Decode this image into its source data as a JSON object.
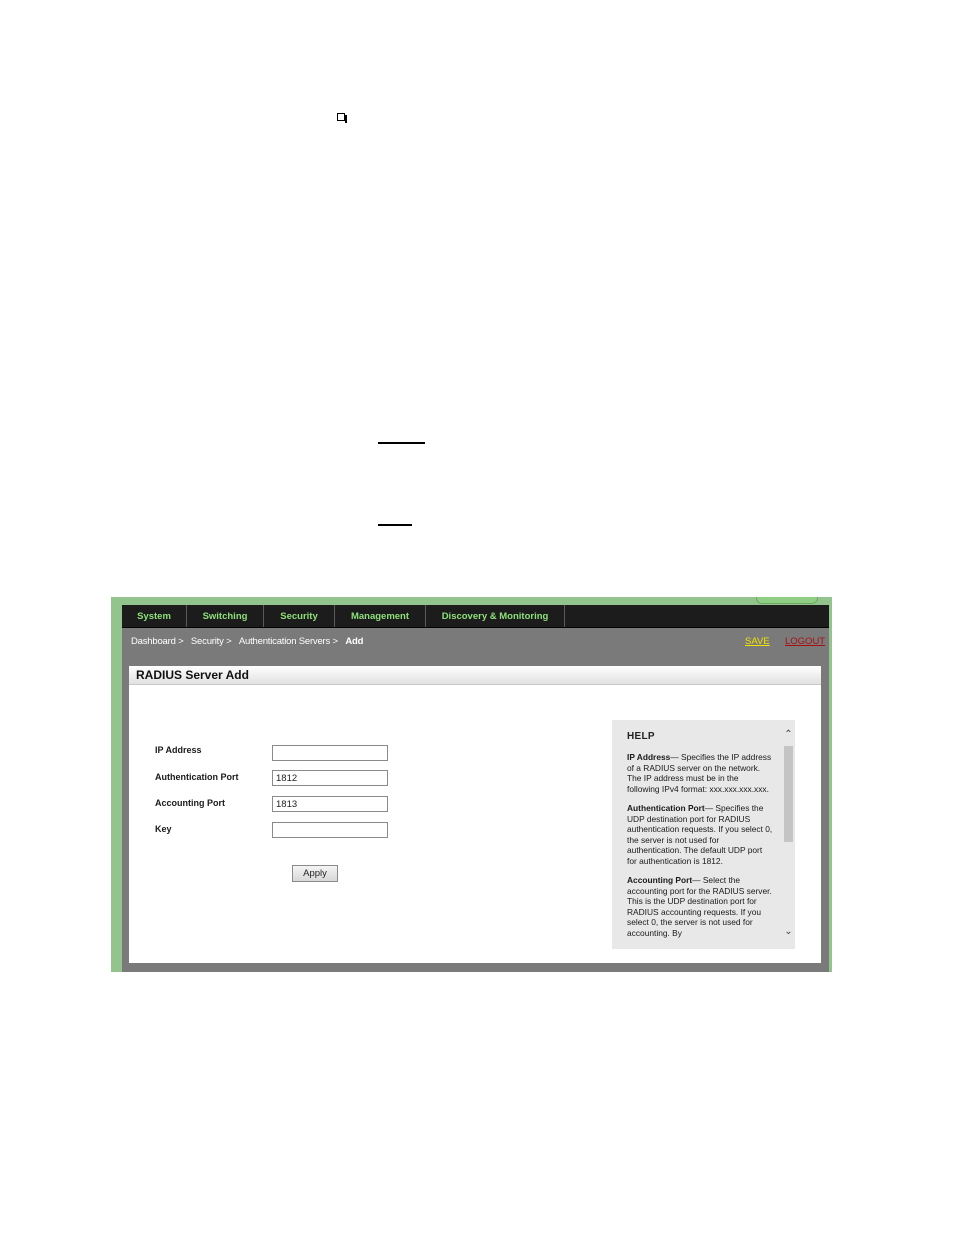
{
  "nav": {
    "items": [
      {
        "label": "System"
      },
      {
        "label": "Switching"
      },
      {
        "label": "Security"
      },
      {
        "label": "Management"
      },
      {
        "label": "Discovery & Monitoring"
      }
    ]
  },
  "breadcrumb": {
    "items": [
      "Dashboard >",
      "Security >",
      "Authentication Servers >"
    ],
    "current": "Add"
  },
  "header_links": {
    "save": "SAVE",
    "logout": "LOGOUT"
  },
  "panel": {
    "title": "RADIUS Server Add"
  },
  "form": {
    "ip_address": {
      "label": "IP Address",
      "value": ""
    },
    "auth_port": {
      "label": "Authentication Port",
      "value": "1812"
    },
    "acct_port": {
      "label": "Accounting Port",
      "value": "1813"
    },
    "key": {
      "label": "Key",
      "value": ""
    },
    "apply_label": "Apply"
  },
  "help": {
    "title": "HELP",
    "sections": [
      {
        "term": "IP Address",
        "text": "— Specifies the IP address of a RADIUS server on the network. The IP address must be in the following IPv4 format: xxx.xxx.xxx.xxx."
      },
      {
        "term": "Authentication Port",
        "text": "— Specifies the UDP destination port for RADIUS authentication requests. If you select 0, the server is not used for authentication. The default UDP port for authentication is 1812."
      },
      {
        "term": "Accounting Port",
        "text": "— Select the accounting port for the RADIUS server. This is the UDP destination port for RADIUS accounting requests. If you select 0, the server is not used for accounting. By"
      }
    ]
  },
  "colors": {
    "nav_text": "#8ee07a",
    "save_link": "#f2e300",
    "logout_link": "#a81010",
    "frame_green": "#93c48e"
  }
}
